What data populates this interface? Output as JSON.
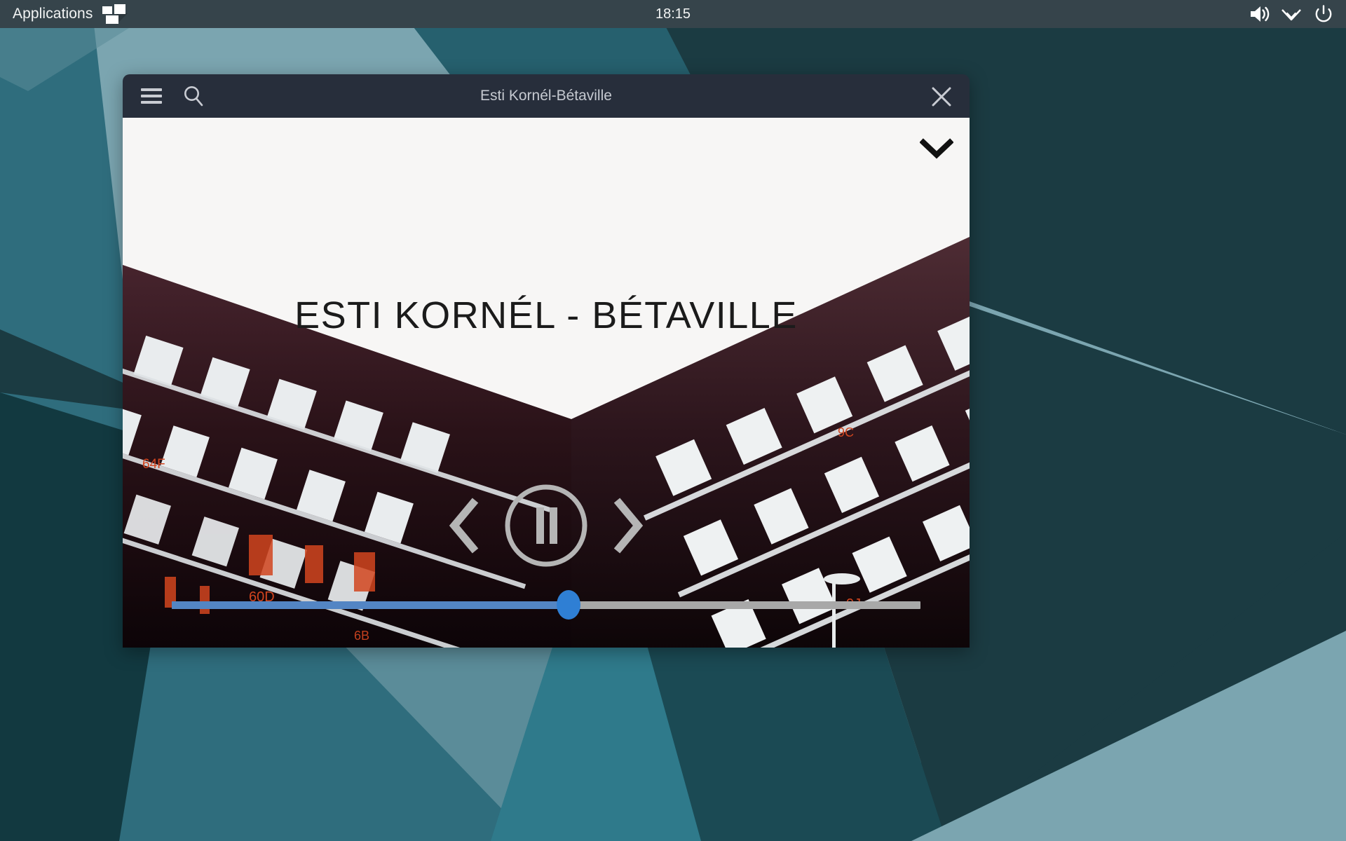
{
  "desktop": {
    "wallpaper": {
      "base_color": "#6f9aa6",
      "palette": [
        "#1b3b42",
        "#2f6d7d",
        "#4c8795",
        "#7ba5b0",
        "#0f2a30",
        "#26606e"
      ]
    }
  },
  "top_panel": {
    "background": "#36444b",
    "applications_label": "Applications",
    "applications_icon": "tiles-icon",
    "clock": "18:15",
    "tray": [
      {
        "name": "volume-icon",
        "label": "Volume"
      },
      {
        "name": "network-icon",
        "label": "Network"
      },
      {
        "name": "power-icon",
        "label": "Power"
      }
    ]
  },
  "window": {
    "title": "Esti Kornél-Bétaville",
    "titlebar_background": "#272e3b",
    "menu_icon": "hamburger-menu-icon",
    "search_icon": "search-icon",
    "close_icon": "close-icon",
    "collapse_icon": "chevron-down-icon"
  },
  "player": {
    "video_title_overlay": "ESTI KORNÉL - BÉTAVILLE",
    "state": "playing",
    "play_pause_icon": "pause-icon",
    "previous_icon": "chevron-left-icon",
    "next_icon": "chevron-right-icon",
    "progress_percent": 53,
    "progress_fill_color": "#5385c4",
    "progress_track_color": "#a8a8a8",
    "progress_thumb_color": "#2f7fd4"
  }
}
